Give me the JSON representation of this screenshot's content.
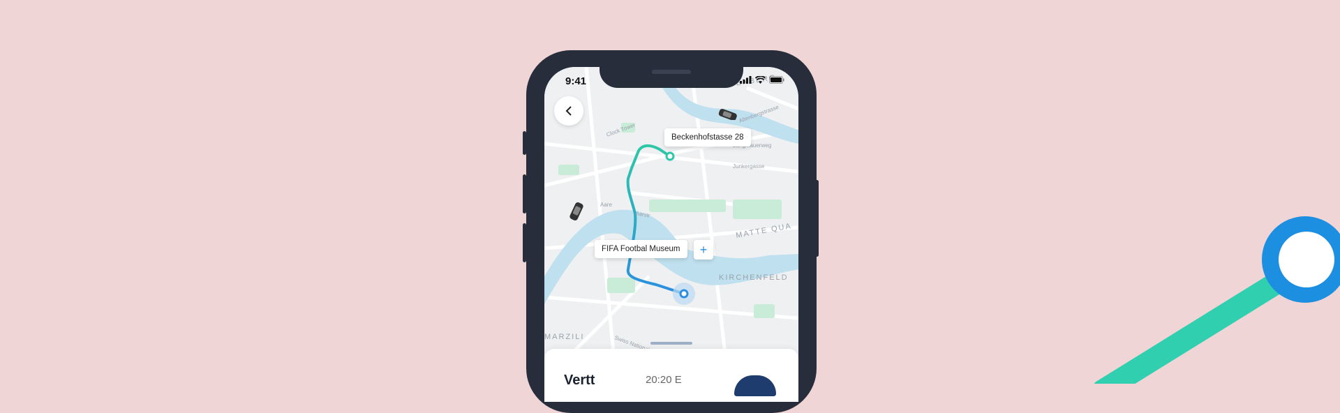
{
  "status_bar": {
    "time": "9:41"
  },
  "map": {
    "origin_label": "Beckenhofstasse 28",
    "destination_label": "FIFA Footbal Museum",
    "add_stop_label": "+",
    "street_labels": [
      "ALTENBERG",
      "Altenbergstrasse",
      "Langmauerweg",
      "Clock Tower",
      "Junkergasse",
      "Aare",
      "Aarstr",
      "MATTE QUA",
      "MARZILI",
      "KIRCHENFELD",
      "Swiss National Li..."
    ],
    "route_color": "#2fc7a8",
    "route_color_end": "#2b8ee0"
  },
  "sheet": {
    "title": "Vertt",
    "time": "20:20 E"
  },
  "colors": {
    "background": "#efd5d5",
    "phone": "#272d3b",
    "accent_teal": "#2fc7a8",
    "accent_blue": "#1d8fe0"
  }
}
